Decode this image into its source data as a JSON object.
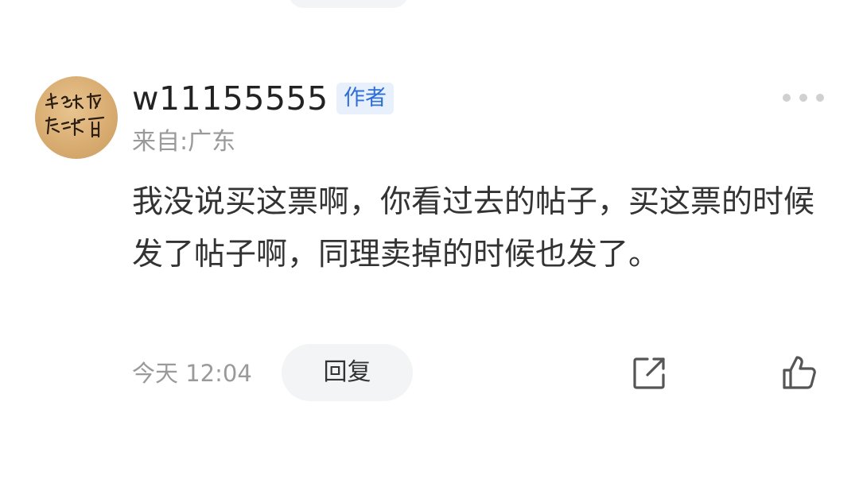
{
  "comment": {
    "username": "w11155555",
    "author_badge": "作者",
    "location": "来自:广东",
    "content": "我没说买这票啊，你看过去的帖子，买这票的时候发了帖子啊，同理卖掉的时候也发了。",
    "time": "今天 12:04",
    "reply_label": "回复",
    "icons": {
      "more": "more-dots-icon",
      "share": "share-external-icon",
      "like": "thumbs-up-icon"
    }
  },
  "colors": {
    "badge_bg": "#e7f0fb",
    "badge_text": "#2f6fd6",
    "muted_text": "#9a9a9a",
    "body_text": "#333333"
  }
}
